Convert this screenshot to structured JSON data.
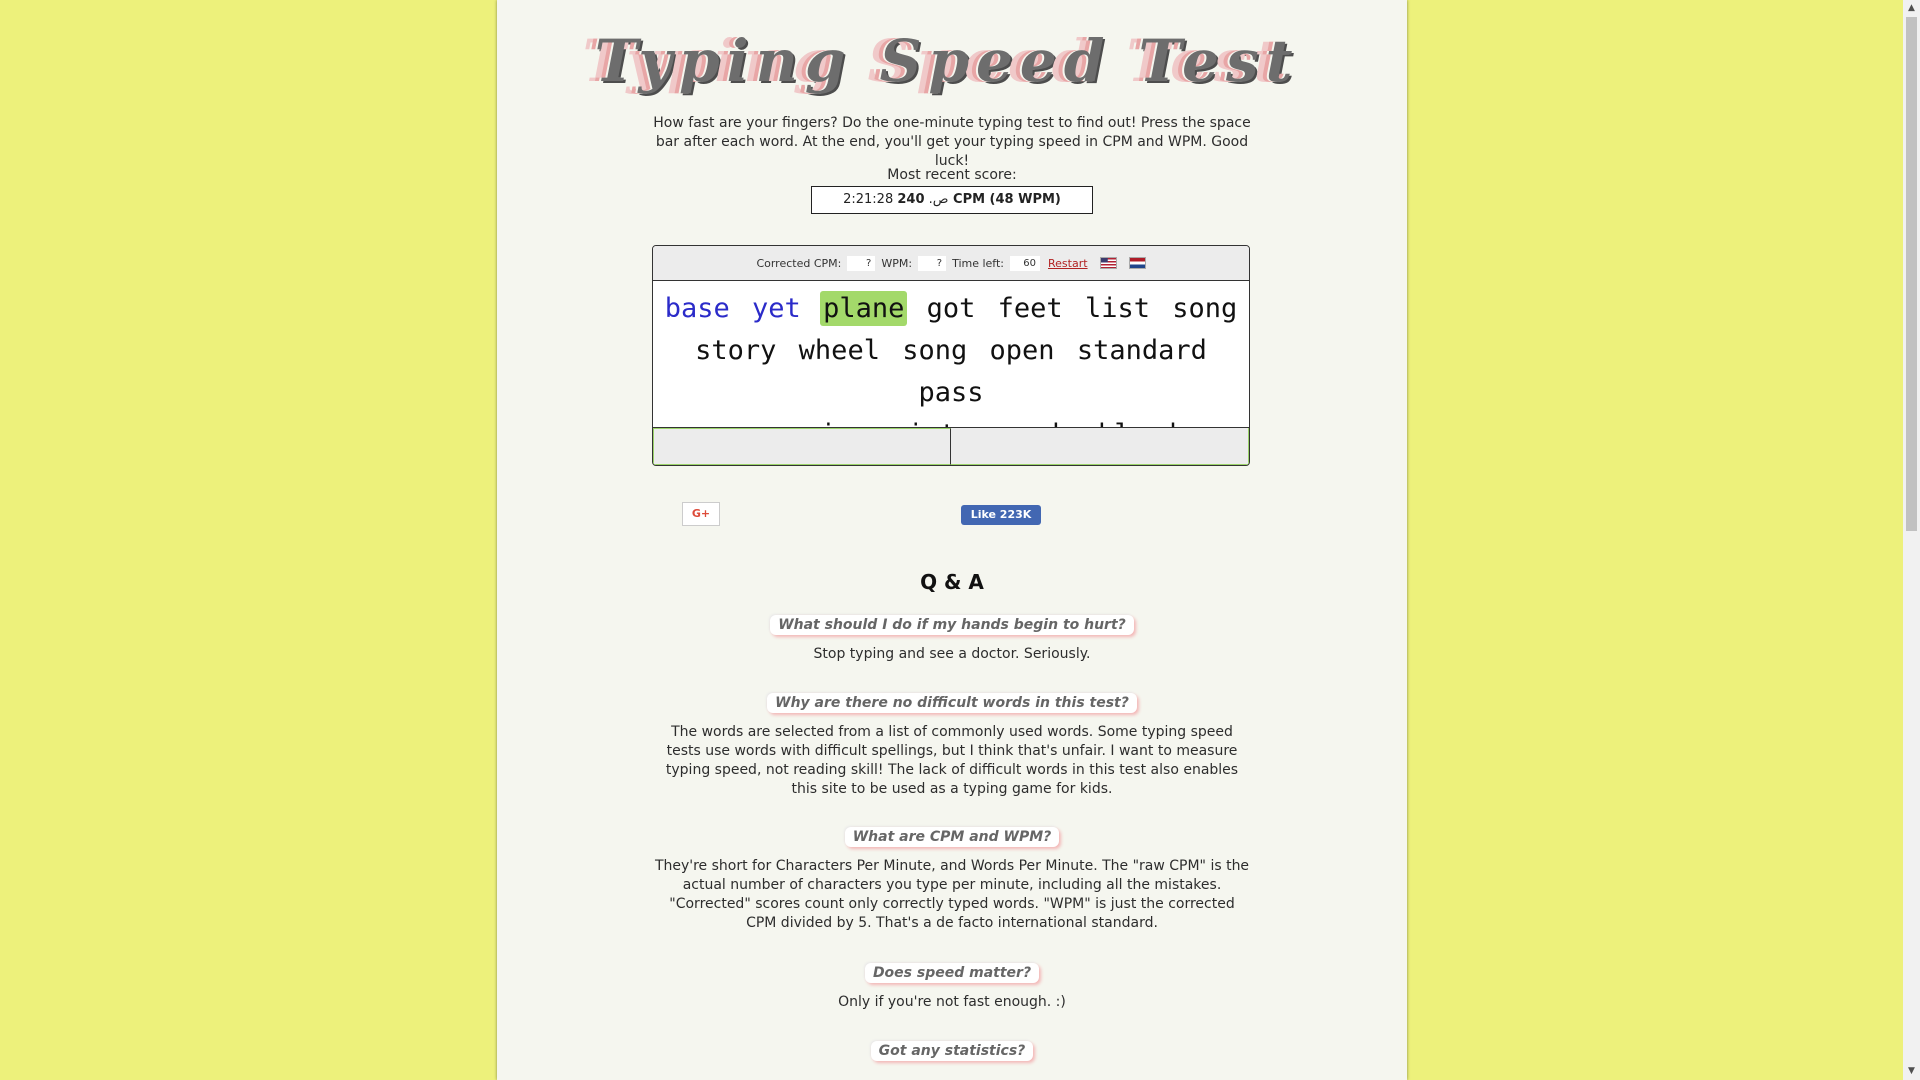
{
  "header": {
    "logo_text": "Typing Speed Test"
  },
  "intro": {
    "text": "How fast are your fingers? Do the one-minute typing test to find out! Press the space bar after each word. At the end, you'll get your typing speed in CPM and WPM. Good luck!"
  },
  "recent_score": {
    "label": "Most recent score:",
    "time_prefix": "2:21:28 ص.",
    "score": "240 CPM (48 WPM)"
  },
  "toolbar": {
    "corrected_cpm_label": "Corrected CPM:",
    "corrected_cpm_value": "?",
    "wpm_label": "WPM:",
    "wpm_value": "?",
    "time_left_label": "Time left:",
    "time_left_value": "60",
    "restart_label": "Restart"
  },
  "words": {
    "line1": [
      "base",
      "yet",
      "plane",
      "got",
      "feet",
      "list",
      "song"
    ],
    "line2": [
      "story",
      "wheel",
      "song",
      "open",
      "standard",
      "pass"
    ],
    "line3": [
      "seven",
      "music",
      "paint",
      "pound",
      "able",
      "been"
    ]
  },
  "social": {
    "gplus_label": "G+",
    "fb_label": "Like 223K"
  },
  "qa": {
    "title": "Q & A",
    "items": [
      {
        "q": "What should I do if my hands begin to hurt?",
        "a": "Stop typing and see a doctor. Seriously."
      },
      {
        "q": "Why are there no difficult words in this test?",
        "a": "The words are selected from a list of commonly used words. Some typing speed tests use words with difficult spellings, but I think that's unfair. I want to measure typing speed, not reading skill! The lack of difficult words in this test also enables this site to be used as a typing game for kids."
      },
      {
        "q": "What are CPM and WPM?",
        "a": "They're short for Characters Per Minute, and Words Per Minute. The \"raw CPM\" is the actual number of characters you type per minute, including all the mistakes. \"Corrected\" scores count only correctly typed words. \"WPM\" is just the corrected CPM divided by 5. That's a de facto international standard."
      },
      {
        "q": "Does speed matter?",
        "a": "Only if you're not fast enough. :)"
      },
      {
        "q": "Got any statistics?",
        "a": ""
      }
    ]
  }
}
